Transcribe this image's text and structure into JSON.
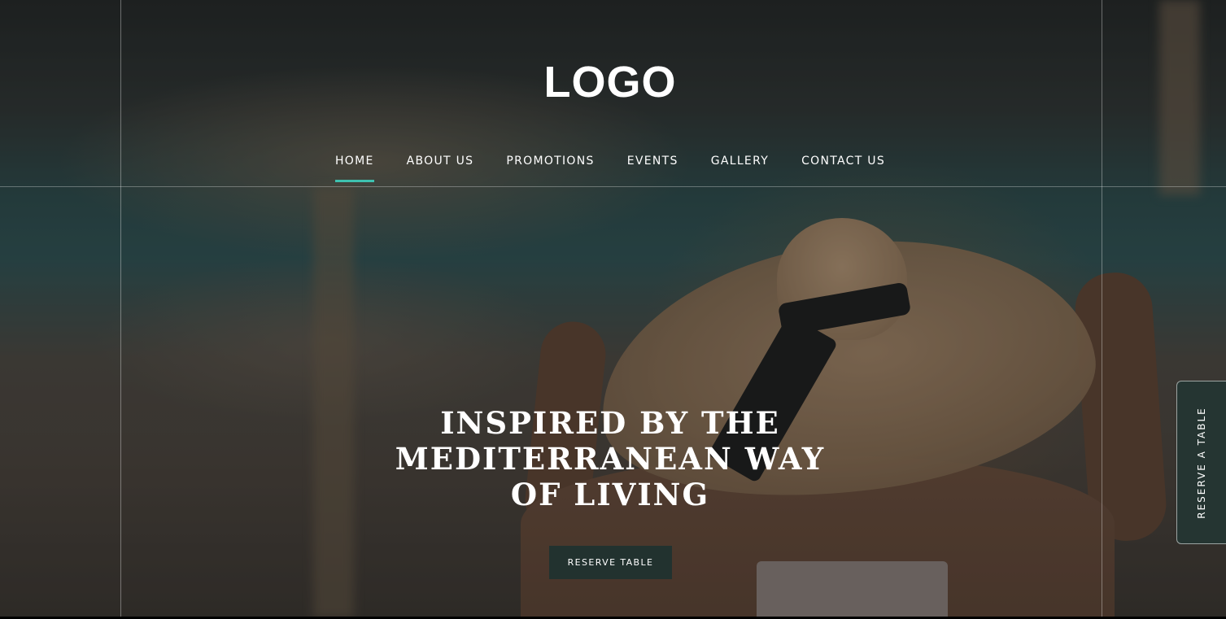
{
  "header": {
    "logo_text": "LOGO"
  },
  "nav": {
    "items": [
      {
        "label": "HOME",
        "active": true
      },
      {
        "label": "ABOUT US",
        "active": false
      },
      {
        "label": "PROMOTIONS",
        "active": false
      },
      {
        "label": "EVENTS",
        "active": false
      },
      {
        "label": "GALLERY",
        "active": false
      },
      {
        "label": "CONTACT US",
        "active": false
      }
    ],
    "active_indicator_color": "#3ec1b0"
  },
  "hero": {
    "headline_line1": "INSPIRED BY THE",
    "headline_line2": "MEDITERRANEAN WAY",
    "headline_line3": "OF LIVING",
    "cta_label": "RESERVE TABLE",
    "cta_color": "#22322f"
  },
  "side_tab": {
    "label": "RESERVE A TABLE"
  }
}
